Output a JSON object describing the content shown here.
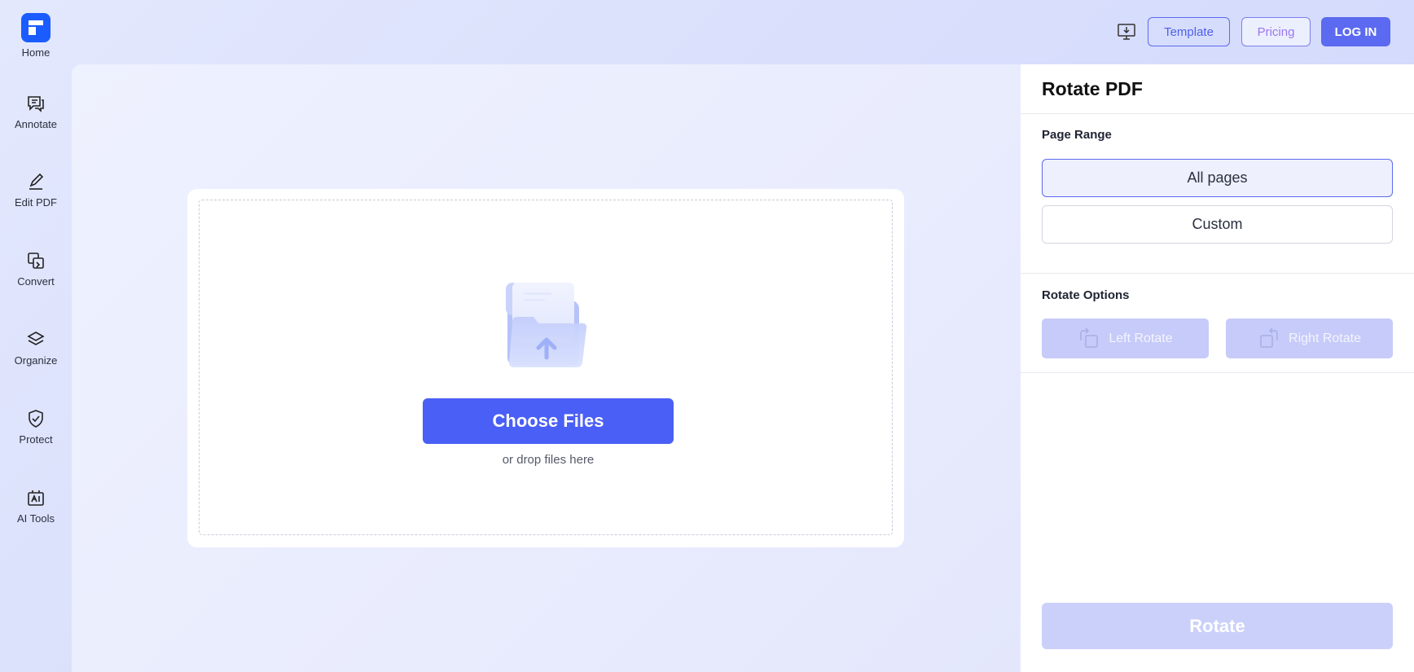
{
  "sidebar": {
    "home_label": "Home",
    "items": [
      {
        "label": "Annotate",
        "icon": "annotate-icon"
      },
      {
        "label": "Edit PDF",
        "icon": "edit-pdf-icon"
      },
      {
        "label": "Convert",
        "icon": "convert-icon"
      },
      {
        "label": "Organize",
        "icon": "organize-icon"
      },
      {
        "label": "Protect",
        "icon": "protect-icon"
      },
      {
        "label": "AI Tools",
        "icon": "ai-tools-icon"
      }
    ]
  },
  "topbar": {
    "download_icon": "desktop-download-icon",
    "template_label": "Template",
    "pricing_label": "Pricing",
    "login_label": "LOG IN"
  },
  "upload": {
    "choose_label": "Choose Files",
    "drop_hint": "or drop files here"
  },
  "panel": {
    "title": "Rotate PDF",
    "page_range_label": "Page Range",
    "range_options": [
      "All pages",
      "Custom"
    ],
    "selected_range": "All pages",
    "rotate_options_label": "Rotate Options",
    "left_rotate_label": "Left Rotate",
    "right_rotate_label": "Right Rotate",
    "rotate_button_label": "Rotate"
  },
  "colors": {
    "accent": "#4a5ff5",
    "brand_logo": "#1a5cff",
    "disabled_button": "#c6cbf9"
  }
}
